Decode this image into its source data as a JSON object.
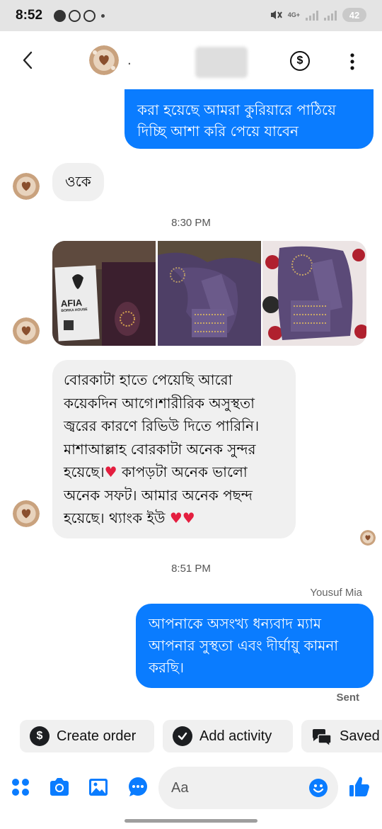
{
  "status_bar": {
    "time": "8:52",
    "network_label": "4G+",
    "battery": "42"
  },
  "header": {
    "contact_name": "·",
    "dollar_icon": "dollar-icon",
    "more_icon": "more-vertical-icon",
    "back_icon": "chevron-left-icon"
  },
  "messages": {
    "outgoing_1_line1": "করা হয়েছে আমরা কুরিয়ারে পাঠিয়ে",
    "outgoing_1_line2": "দিচ্ছি আশা করি পেয়ে যাবেন",
    "incoming_1": "ওকে",
    "time_1": "8:30 PM",
    "photo_brand_line1": "AFIA",
    "photo_brand_line2": "BORKA HOUSE",
    "incoming_2_lines": [
      "বোরকাটা হাতে পেয়েছি আরো",
      "কয়েকদিন আগে।শারীরিক অসুস্থতা",
      "জ্বরের কারণে রিভিউ দিতে পারিনি।",
      "মাশাআল্লাহ বোরকাটা অনেক সুন্দর",
      "হয়েছে।",
      "কাপড়টা অনেক ভালো",
      "অনেক সফট। আমার অনেক পছন্দ",
      "হয়েছে। থ্যাংক ইউ"
    ],
    "heart": "♥",
    "time_2": "8:51 PM",
    "sender_name": "Yousuf Mia",
    "outgoing_2_lines": [
      "আপনাকে অসংখ্য ধন্যবাদ ম্যাম",
      "আপনার সুস্থতা এবং দীর্ঘায়ু কামনা",
      "করছি।"
    ],
    "sent_status": "Sent"
  },
  "quick_actions": {
    "create_order": "Create order",
    "create_order_icon": "$",
    "add_activity": "Add activity",
    "saved": "Saved"
  },
  "composer": {
    "placeholder": "Aa"
  },
  "colors": {
    "outgoing_bubble": "#0a7cff",
    "incoming_bubble": "#f0f0f0",
    "accent": "#0a7cff",
    "heart": "#e41e3f"
  }
}
